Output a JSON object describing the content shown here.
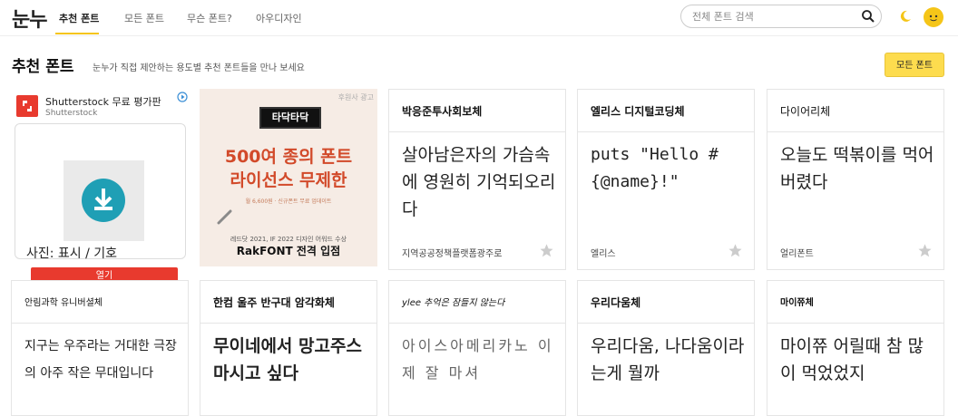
{
  "header": {
    "logo": "눈누",
    "nav": [
      "추천 폰트",
      "모든 폰트",
      "무슨 폰트?",
      "아우디자인"
    ],
    "search_placeholder": "전체 폰트 검색"
  },
  "section": {
    "title": "추천 폰트",
    "subtitle": "눈누가 직접 제안하는 용도별 추천 폰트들을 만나 보세요",
    "all_button": "모든 폰트"
  },
  "ads": {
    "shutterstock": {
      "title": "Shutterstock 무료 평가판",
      "subtitle": "Shutterstock",
      "caption": "사진: 표시 / 기호",
      "button": "열기"
    },
    "rakfont": {
      "sponsor": "후원사 광고",
      "badge": "타닥타닥",
      "line1": "500여 종의 폰트",
      "line2": "라이선스 무제한",
      "small": "월 6,600원 · 신규폰트 무료 업데이트",
      "award": "레드닷 2021, IF 2022 디자인 어워드 수상",
      "brand": "RakFONT 전격 입점"
    }
  },
  "cards": [
    {
      "name": "박응준투사회보체",
      "sample": "살아남은자의 가슴속에 영원히 기억되오리다",
      "author": "지역공공정책플랫폼광주로"
    },
    {
      "name": "엘리스 디지털코딩체",
      "sample": "puts \"Hello #{@name}!\"",
      "author": "엘리스"
    },
    {
      "name": "다이어리체",
      "sample": "오늘도 떡볶이를 먹어버렸다",
      "author": "얼리폰트"
    },
    {
      "name": "안림과학 유니버셜체",
      "sample": "지구는 우주라는 거대한 극장의 아주 작은 무대입니다",
      "author": ""
    },
    {
      "name": "한컴 울주 반구대 암각화체",
      "sample": "무이네에서 망고주스 마시고 싶다",
      "author": ""
    },
    {
      "name": "ylee 추억은 잠들지 않는다",
      "sample": "아이스아메리카노 이제 잘 마셔",
      "author": ""
    },
    {
      "name": "우리다움체",
      "sample": "우리다움, 나다움이라는게 뭘까",
      "author": ""
    },
    {
      "name": "마이쮸체",
      "sample": "마이쮸 어릴때 참 많이 먹었었지",
      "author": ""
    }
  ],
  "colors": {
    "accent": "#f5c518",
    "button": "#fddc4e",
    "ad_red": "#e83a2e"
  }
}
